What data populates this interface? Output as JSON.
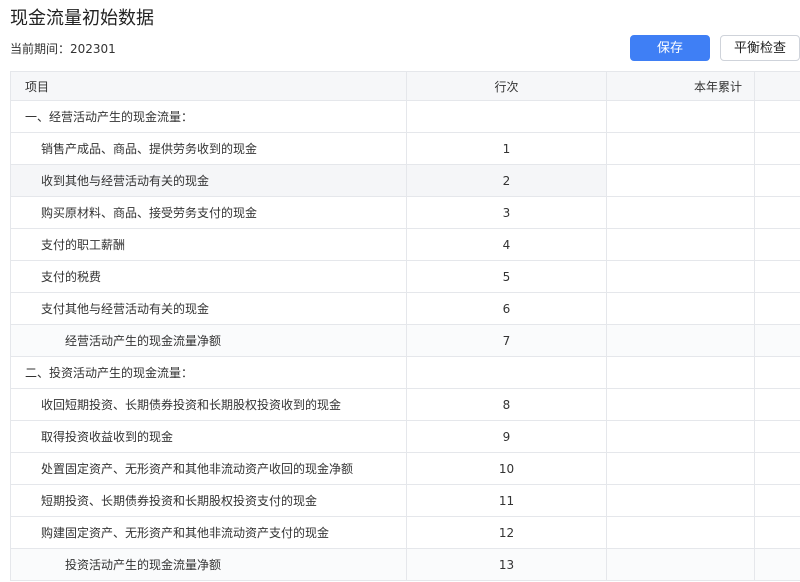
{
  "page": {
    "title": "现金流量初始数据",
    "period_label": "当前期间：202301"
  },
  "toolbar": {
    "save_label": "保存",
    "check_label": "平衡检查"
  },
  "table": {
    "headers": {
      "item": "项目",
      "line": "行次",
      "ytd": "本年累计"
    },
    "rows": [
      {
        "item": "一、经营活动产生的现金流量：",
        "line": "",
        "ytd": ""
      },
      {
        "item": "销售产成品、商品、提供劳务收到的现金",
        "line": "1",
        "ytd": ""
      },
      {
        "item": "收到其他与经营活动有关的现金",
        "line": "2",
        "ytd": ""
      },
      {
        "item": "购买原材料、商品、接受劳务支付的现金",
        "line": "3",
        "ytd": ""
      },
      {
        "item": "支付的职工薪酬",
        "line": "4",
        "ytd": ""
      },
      {
        "item": "支付的税费",
        "line": "5",
        "ytd": ""
      },
      {
        "item": "支付其他与经营活动有关的现金",
        "line": "6",
        "ytd": ""
      },
      {
        "item": "经营活动产生的现金流量净额",
        "line": "7",
        "ytd": ""
      },
      {
        "item": "二、投资活动产生的现金流量：",
        "line": "",
        "ytd": ""
      },
      {
        "item": "收回短期投资、长期债券投资和长期股权投资收到的现金",
        "line": "8",
        "ytd": ""
      },
      {
        "item": "取得投资收益收到的现金",
        "line": "9",
        "ytd": ""
      },
      {
        "item": "处置固定资产、无形资产和其他非流动资产收回的现金净额",
        "line": "10",
        "ytd": ""
      },
      {
        "item": "短期投资、长期债券投资和长期股权投资支付的现金",
        "line": "11",
        "ytd": ""
      },
      {
        "item": "购建固定资产、无形资产和其他非流动资产支付的现金",
        "line": "12",
        "ytd": ""
      },
      {
        "item": "投资活动产生的现金流量净额",
        "line": "13",
        "ytd": ""
      }
    ]
  },
  "colors": {
    "primary": "#3f7ff5",
    "header_bg": "#f6f7f9",
    "border": "#e5e7eb",
    "row_hover": "#f5f6f8"
  }
}
